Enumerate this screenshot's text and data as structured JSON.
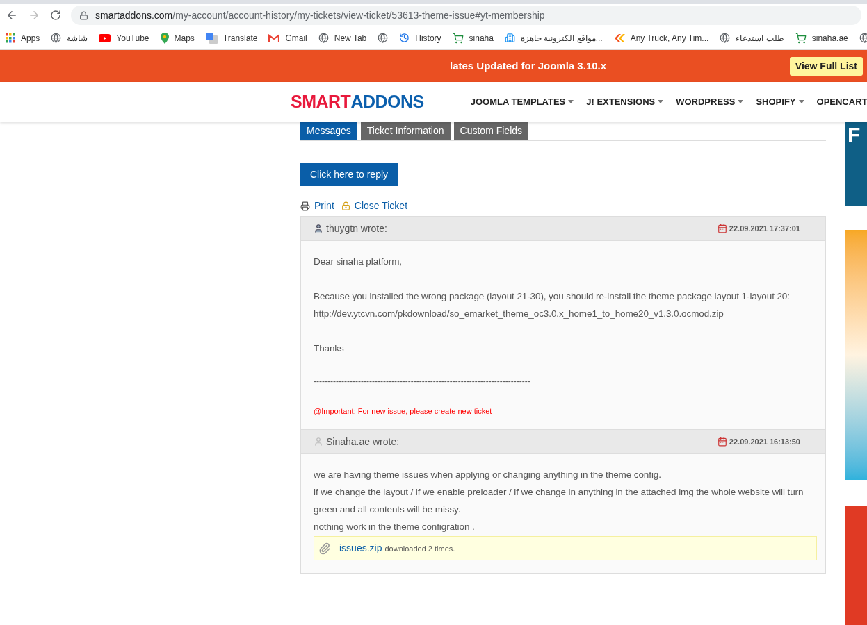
{
  "browser": {
    "url_host": "smartaddons.com",
    "url_path": "/my-account/account-history/my-tickets/view-ticket/53613-theme-issue#yt-membership",
    "bookmarks": [
      {
        "kind": "apps",
        "label": "Apps"
      },
      {
        "kind": "globe",
        "label": "شاشة"
      },
      {
        "kind": "youtube",
        "label": "YouTube"
      },
      {
        "kind": "maps",
        "label": "Maps"
      },
      {
        "kind": "translate",
        "label": "Translate"
      },
      {
        "kind": "gmail",
        "label": "Gmail"
      },
      {
        "kind": "globe",
        "label": "New Tab"
      },
      {
        "kind": "globe"
      },
      {
        "kind": "history",
        "label": "History"
      },
      {
        "kind": "cart",
        "label": "sinaha"
      },
      {
        "kind": "building",
        "label": "مواقع الكترونية جاهزة..."
      },
      {
        "kind": "chevrons",
        "label": "Any Truck, Any Tim..."
      },
      {
        "kind": "globe",
        "label": "طلب استدعاء"
      },
      {
        "kind": "cart",
        "label": "sinaha.ae"
      },
      {
        "kind": "globe"
      }
    ]
  },
  "announcement": {
    "text": "lates Updated for Joomla 3.10.x",
    "button": "View Full List"
  },
  "header": {
    "logo_first": "SMART",
    "logo_second": "ADDONS",
    "nav": [
      "JOOMLA TEMPLATES",
      "J! EXTENSIONS",
      "WORDPRESS",
      "SHOPIFY",
      "OPENCART"
    ]
  },
  "tabs": [
    {
      "label": "Messages",
      "selected": true
    },
    {
      "label": "Ticket Information",
      "selected": false
    },
    {
      "label": "Custom Fields",
      "selected": false
    }
  ],
  "reply_button": "Click here to reply",
  "actions": [
    {
      "kind": "print",
      "label": "Print"
    },
    {
      "kind": "lock",
      "label": "Close Ticket"
    }
  ],
  "messages": [
    {
      "author": "thuygtn wrote:",
      "kind": "staff",
      "date": "22.09.2021 17:37:01",
      "body": [
        {
          "kind": "text",
          "lines": [
            "Dear sinaha platform,"
          ]
        },
        {
          "kind": "text",
          "lines": [
            "Because you installed the wrong package (layout 21-30), you should re-install the theme package layout 1-layout 20:",
            "http://dev.ytcvn.com/pkdownload/so_emarket_theme_oc3.0.x_home1_to_home20_v1.3.0.ocmod.zip"
          ]
        },
        {
          "kind": "text",
          "lines": [
            "Thanks"
          ]
        },
        {
          "kind": "separator",
          "lines": [
            "------------------------------------------------------------------------------"
          ]
        },
        {
          "kind": "notice",
          "lines": [
            "@Important: For new issue, please create new ticket"
          ]
        }
      ]
    },
    {
      "author": "Sinaha.ae wrote:",
      "kind": "user",
      "date": "22.09.2021 16:13:50",
      "body": [
        {
          "kind": "compact",
          "lines": [
            "we are having theme issues when applying or changing anything in the theme config.",
            "if we change the layout / if we enable preloader / if we change in anything in the attached img the whole website will turn green and all contents will be missy.",
            "nothing work in the theme configration ."
          ]
        }
      ],
      "attachment": {
        "name": "issues.zip",
        "note": "downloaded 2 times."
      }
    }
  ],
  "side_banner_text": "F"
}
